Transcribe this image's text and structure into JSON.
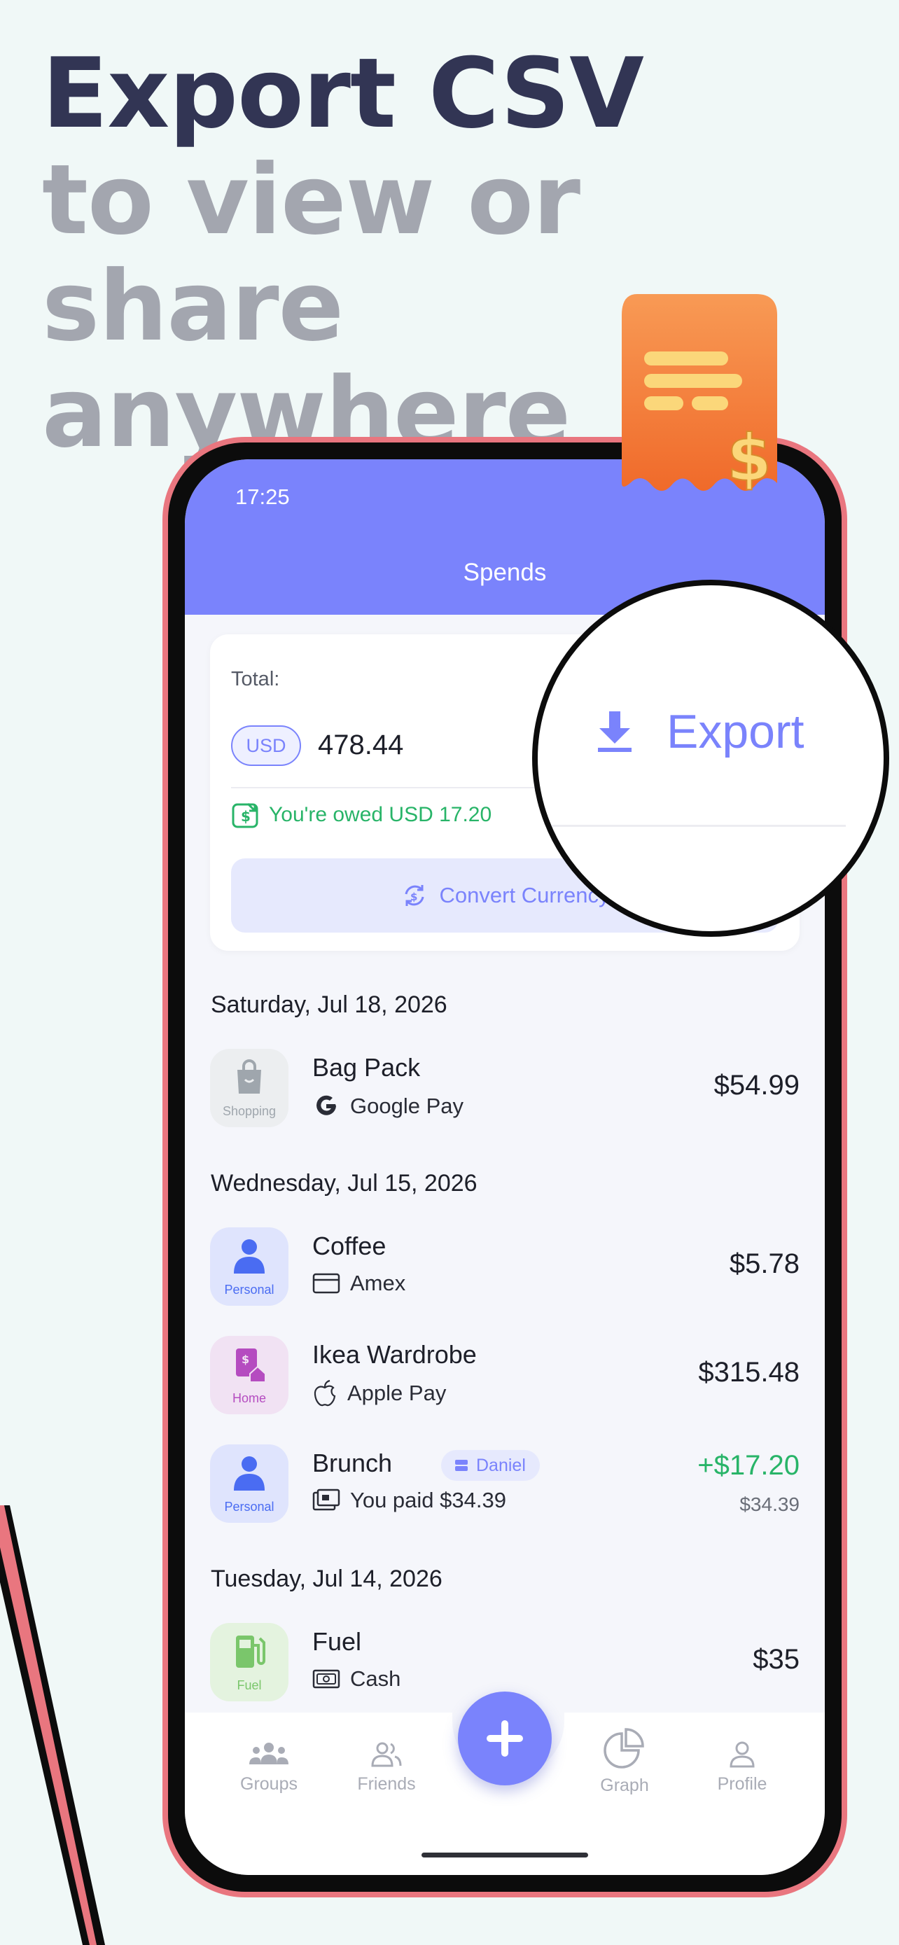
{
  "headline": {
    "line1": "Export CSV",
    "line2": "to view or share",
    "line3": "anywhere"
  },
  "status_bar": {
    "time": "17:25"
  },
  "header": {
    "title": "Spends"
  },
  "summary": {
    "total_label": "Total:",
    "currency": "USD",
    "total_value": "478.44",
    "owed_text": "You're owed USD 17.20",
    "convert_label": "Convert Currency",
    "export_label": "Export"
  },
  "colors": {
    "accent": "#7a83fc",
    "positive": "#28b468",
    "frame": "#e9767f",
    "receipt": "#f47f3d"
  },
  "groups": [
    {
      "date": "Saturday, Jul 18, 2026",
      "items": [
        {
          "name": "Bag Pack",
          "method": "Google Pay",
          "method_icon": "google-icon",
          "category": "Shopping",
          "category_icon": "shopping-bag-icon",
          "amount": "$54.99"
        }
      ]
    },
    {
      "date": "Wednesday, Jul 15, 2026",
      "items": [
        {
          "name": "Coffee",
          "method": "Amex",
          "method_icon": "card-icon",
          "category": "Personal",
          "category_icon": "person-icon",
          "amount": "$5.78"
        },
        {
          "name": "Ikea Wardrobe",
          "method": "Apple Pay",
          "method_icon": "apple-icon",
          "category": "Home",
          "category_icon": "home-bill-icon",
          "amount": "$315.48"
        },
        {
          "name": "Brunch",
          "tag": "Daniel",
          "method": "You paid $34.39",
          "method_icon": "cash-register-icon",
          "category": "Personal",
          "category_icon": "person-icon",
          "amount": "+$17.20",
          "sub_amount": "$34.39"
        }
      ]
    },
    {
      "date": "Tuesday, Jul 14, 2026",
      "items": [
        {
          "name": "Fuel",
          "method": "Cash",
          "method_icon": "cash-icon",
          "category": "Fuel",
          "category_icon": "fuel-pump-icon",
          "amount": "$35"
        }
      ]
    }
  ],
  "tabs": [
    {
      "label": "Groups",
      "icon": "groups-icon"
    },
    {
      "label": "Friends",
      "icon": "friends-icon"
    },
    {
      "label": "Graph",
      "icon": "pie-chart-icon"
    },
    {
      "label": "Profile",
      "icon": "profile-icon"
    }
  ],
  "fab": {
    "icon": "plus-icon"
  }
}
